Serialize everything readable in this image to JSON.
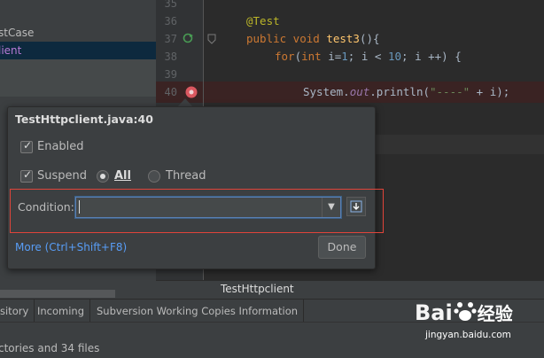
{
  "project_tree": {
    "row1": "stCase",
    "row2": "lient"
  },
  "editor": {
    "lines": [
      {
        "number": "35"
      },
      {
        "number": "36"
      },
      {
        "number": "37"
      },
      {
        "number": "38"
      },
      {
        "number": "39"
      },
      {
        "number": "40"
      }
    ],
    "code": {
      "annotation": "@Test",
      "line37_kw": "public void ",
      "line37_fn": "test3",
      "line37_rest": "(){",
      "line38_for": "for",
      "line38_a": "(",
      "line38_int": "int",
      "line38_b": " i=",
      "line38_n1": "1",
      "line38_c": "; i < ",
      "line38_n2": "10",
      "line38_d": "; i ++) {",
      "line40_a": "System.",
      "line40_out": "out",
      "line40_b": ".println(",
      "line40_str": "\"----\"",
      "line40_c": " + i);"
    },
    "status_tab_title": "TestHttpclient"
  },
  "dialog": {
    "title": "TestHttpclient.java:40",
    "enabled_label": "Enabled",
    "enabled_checked": true,
    "suspend_label": "Suspend",
    "suspend_checked": true,
    "all_label": "All",
    "thread_label": "Thread",
    "suspend_policy": "All",
    "condition_label": "Condition:",
    "condition_value": "",
    "more_link": "More (Ctrl+Shift+F8)",
    "done_label": "Done"
  },
  "bottom_tabs": [
    {
      "label": "sitory"
    },
    {
      "label": "Incoming"
    },
    {
      "label": "Subversion Working Copies Information"
    }
  ],
  "bottom_status": "ctories and 34 files",
  "watermark": {
    "logo": "Bai du 经验",
    "url": "jingyan.baidu.com"
  },
  "colors": {
    "highlight_box": "#e0443a",
    "link": "#589df6",
    "breakpoint": "#db5860"
  }
}
